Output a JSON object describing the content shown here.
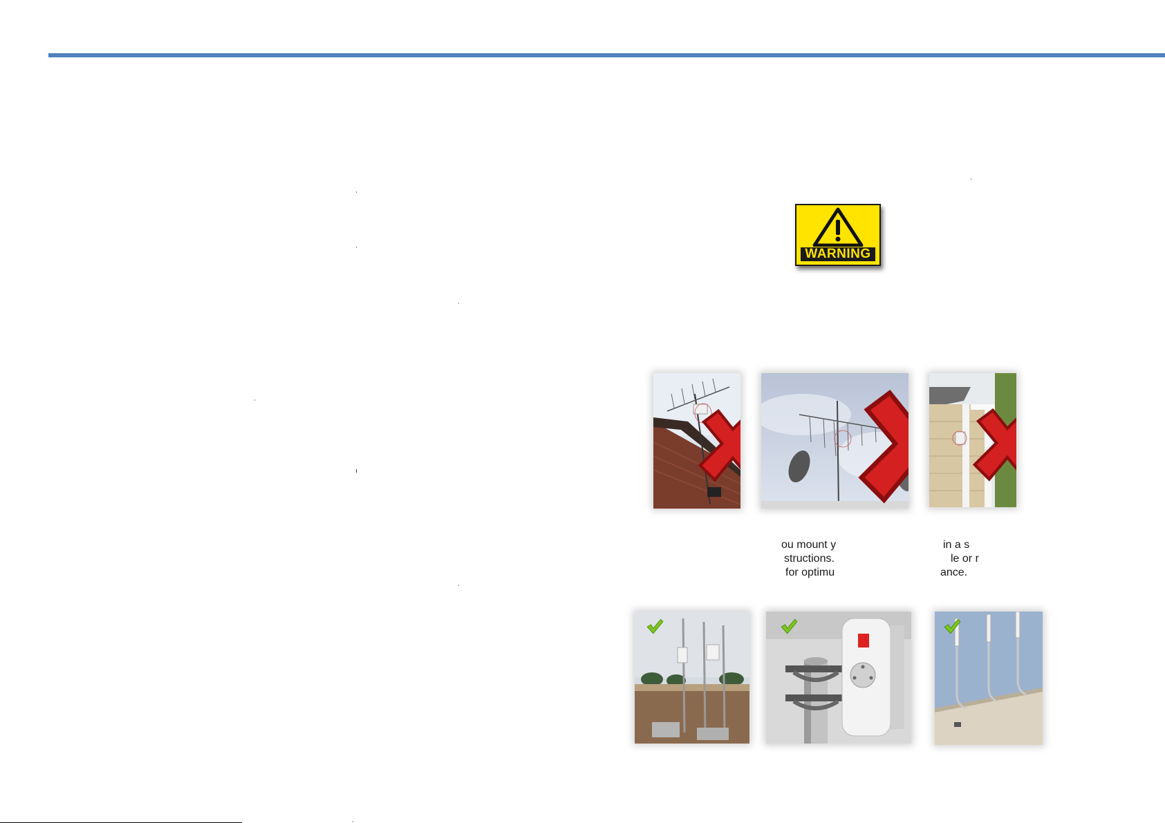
{
  "warning_sign": {
    "label": "WARNING",
    "background": "#ffe400",
    "icon": "warning-triangle-icon"
  },
  "photos_incorrect": [
    {
      "subject": "Indoor panel antenna mounted on a TV antenna mast by a brick roof",
      "mark": "red-x-icon"
    },
    {
      "subject": "Panel antenna among TV antennas and satellite dishes",
      "mark": "red-x-icon"
    },
    {
      "subject": "Antenna on a wall under the eaves of a sided house",
      "mark": "red-x-icon"
    }
  ],
  "photos_correct": [
    {
      "subject": "Antennas on masts with ballast blocks on a flat roof",
      "mark": "green-check-icon"
    },
    {
      "subject": "Panel antenna clamped to a pole with a U-bolt bracket",
      "mark": "green-check-icon"
    },
    {
      "subject": "Omni antennas on wall-mounted masts",
      "mark": "green-check-icon"
    }
  ],
  "caption": {
    "lines": [
      {
        "left": "ou mount y",
        "right": "in a s"
      },
      {
        "left": "structions.",
        "right": "le or r"
      },
      {
        "left": "for optimu",
        "right": "ance."
      }
    ]
  },
  "colors": {
    "rule": "#4f81bd",
    "cross": "#d42020",
    "check": "#7cc61f"
  }
}
